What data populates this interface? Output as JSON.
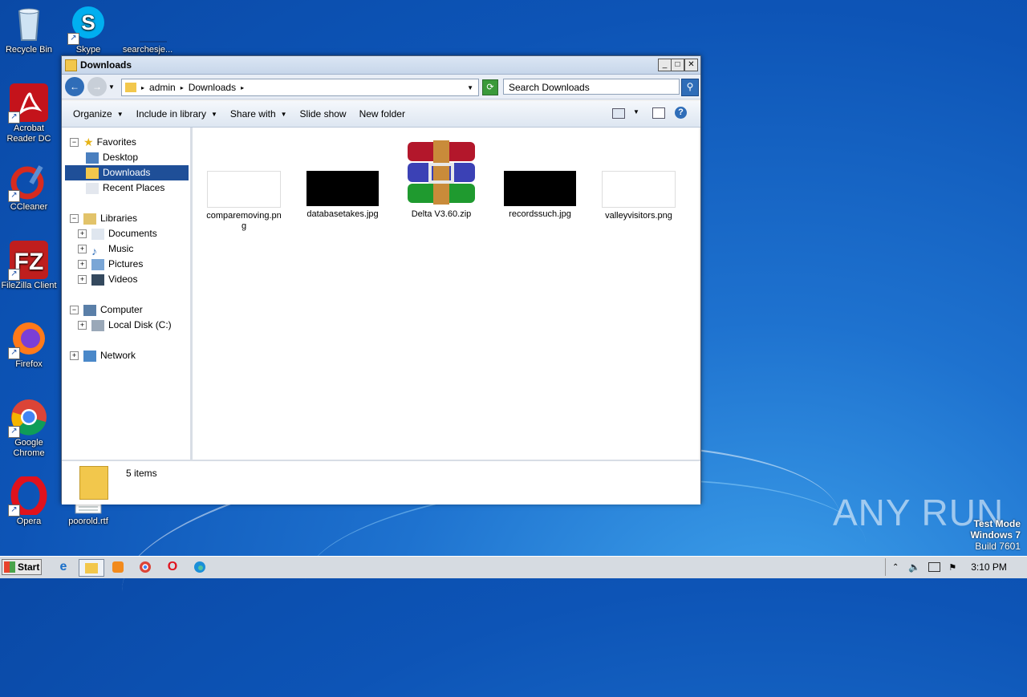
{
  "desktop": {
    "icons": [
      {
        "label": "Recycle Bin"
      },
      {
        "label": "Skype"
      },
      {
        "label": "searchesje..."
      },
      {
        "label": "Acrobat Reader DC"
      },
      {
        "label": "CCleaner"
      },
      {
        "label": "FileZilla Client"
      },
      {
        "label": "Firefox"
      },
      {
        "label": "Google Chrome"
      },
      {
        "label": "Opera"
      },
      {
        "label": "poorold.rtf"
      }
    ]
  },
  "window": {
    "title": "Downloads",
    "breadcrumb": [
      "admin",
      "Downloads"
    ],
    "search_placeholder": "Search Downloads",
    "toolbar": {
      "organize": "Organize",
      "include": "Include in library",
      "share": "Share with",
      "slideshow": "Slide show",
      "newfolder": "New folder"
    },
    "nav": {
      "favorites": "Favorites",
      "desktop": "Desktop",
      "downloads": "Downloads",
      "recent": "Recent Places",
      "libraries": "Libraries",
      "documents": "Documents",
      "music": "Music",
      "pictures": "Pictures",
      "videos": "Videos",
      "computer": "Computer",
      "localdisk": "Local Disk (C:)",
      "network": "Network"
    },
    "files": [
      {
        "name": "comparemoving.png",
        "line1": "comparemoving.pn",
        "line2": "g"
      },
      {
        "name": "databasetakes.jpg"
      },
      {
        "name": "Delta V3.60.zip"
      },
      {
        "name": "recordssuch.jpg"
      },
      {
        "name": "valleyvisitors.png"
      }
    ],
    "status": "5 items"
  },
  "taskbar": {
    "start": "Start",
    "clock": "3:10 PM"
  },
  "watermark": {
    "brand": "ANY RUN",
    "line1": "Test Mode",
    "line2": "Windows 7",
    "line3": "Build 7601"
  },
  "colors": {
    "selection": "#1f4f98",
    "desktop": "#0d54b6"
  }
}
